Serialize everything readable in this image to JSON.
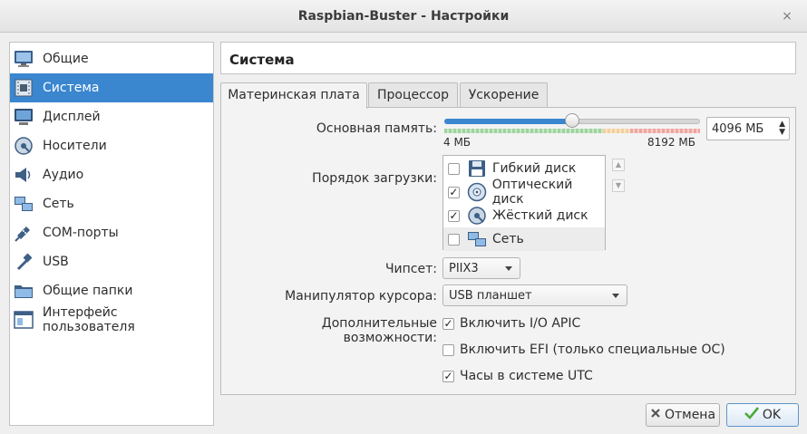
{
  "window": {
    "title": "Raspbian-Buster - Настройки",
    "close_glyph": "×"
  },
  "sidebar": {
    "items": [
      {
        "label": "Общие",
        "icon": "monitor-icon"
      },
      {
        "label": "Система",
        "icon": "chip-icon",
        "selected": true
      },
      {
        "label": "Дисплей",
        "icon": "display-icon"
      },
      {
        "label": "Носители",
        "icon": "disk-icon"
      },
      {
        "label": "Аудио",
        "icon": "speaker-icon"
      },
      {
        "label": "Сеть",
        "icon": "network-icon"
      },
      {
        "label": "COM-порты",
        "icon": "serial-port-icon"
      },
      {
        "label": "USB",
        "icon": "usb-icon"
      },
      {
        "label": "Общие папки",
        "icon": "folder-icon"
      },
      {
        "label": "Интерфейс пользователя",
        "icon": "ui-icon"
      }
    ]
  },
  "section_title": "Система",
  "tabs": [
    {
      "label": "Материнская плата",
      "active": true
    },
    {
      "label": "Процессор"
    },
    {
      "label": "Ускорение"
    }
  ],
  "memory": {
    "label": "Основная память:",
    "value": "4096 МБ",
    "min_label": "4 МБ",
    "max_label": "8192 МБ",
    "slider_fraction": 0.5
  },
  "boot_order": {
    "label": "Порядок загрузки:",
    "items": [
      {
        "label": "Гибкий диск",
        "checked": false,
        "icon": "floppy-icon"
      },
      {
        "label": "Оптический диск",
        "checked": true,
        "icon": "optical-disc-icon"
      },
      {
        "label": "Жёсткий диск",
        "checked": true,
        "icon": "hard-disk-icon"
      },
      {
        "label": "Сеть",
        "checked": false,
        "icon": "network-icon"
      }
    ],
    "check_glyph": "✓"
  },
  "chipset": {
    "label": "Чипсет:",
    "value": "PIIX3"
  },
  "pointing": {
    "label": "Манипулятор курсора:",
    "value": "USB планшет"
  },
  "extended": {
    "label": "Дополнительные возможности:",
    "options": [
      {
        "label": "Включить I/O APIC",
        "checked": true
      },
      {
        "label": "Включить EFI (только специальные ОС)",
        "checked": false
      },
      {
        "label": "Часы в системе UTC",
        "checked": true
      }
    ]
  },
  "buttons": {
    "cancel": "Отмена",
    "ok": "OK"
  },
  "colors": {
    "accent": "#3a86cf",
    "selected_text": "#ffffff"
  }
}
